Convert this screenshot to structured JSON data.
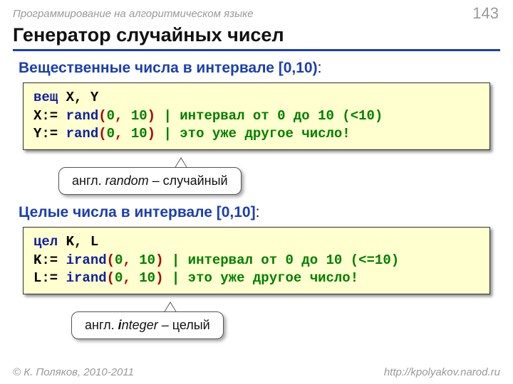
{
  "top": {
    "course": "Программирование на алгоритмическом языке",
    "page": "143"
  },
  "title": "Генератор случайных чисел",
  "real": {
    "heading": "Вещественные числа в интервале [0,10)",
    "code": {
      "l1_type": "вещ",
      "l1_vars": " X, Y",
      "l2_lhs": "X:= ",
      "l2_fn": "rand",
      "l2_op": "(",
      "l2_a": "0",
      "l2_sep": ", ",
      "l2_b": "10",
      "l2_cp": ")",
      "l2_comment": " | интервал от 0 до 10 (<10)",
      "l3_lhs": "Y:= ",
      "l3_fn": "rand",
      "l3_op": "(",
      "l3_a": "0",
      "l3_sep": ", ",
      "l3_b": "10",
      "l3_cp": ")",
      "l3_comment": " | это уже другое число!"
    },
    "callout_prefix": "англ. ",
    "callout_word": "random",
    "callout_suffix": " – случайный"
  },
  "int": {
    "heading": "Целые числа в интервале [0,10]",
    "code": {
      "l1_type": "цел",
      "l1_vars": " K, L",
      "l2_lhs": "K:= ",
      "l2_fn": "irand",
      "l2_op": "(",
      "l2_a": "0",
      "l2_sep": ", ",
      "l2_b": "10",
      "l2_cp": ")",
      "l2_comment": " | интервал от 0 до 10 (<=10)",
      "l3_lhs": "L:= ",
      "l3_fn": "irand",
      "l3_op": "(",
      "l3_a": "0",
      "l3_sep": ", ",
      "l3_b": "10",
      "l3_cp": ")",
      "l3_comment": " | это уже другое число!"
    },
    "callout_prefix": "англ. ",
    "callout_b": "i",
    "callout_rest_word": "nteger",
    "callout_suffix": " – целый"
  },
  "footer": {
    "left": "© К. Поляков, 2010-2011",
    "right": "http://kpolyakov.narod.ru"
  }
}
